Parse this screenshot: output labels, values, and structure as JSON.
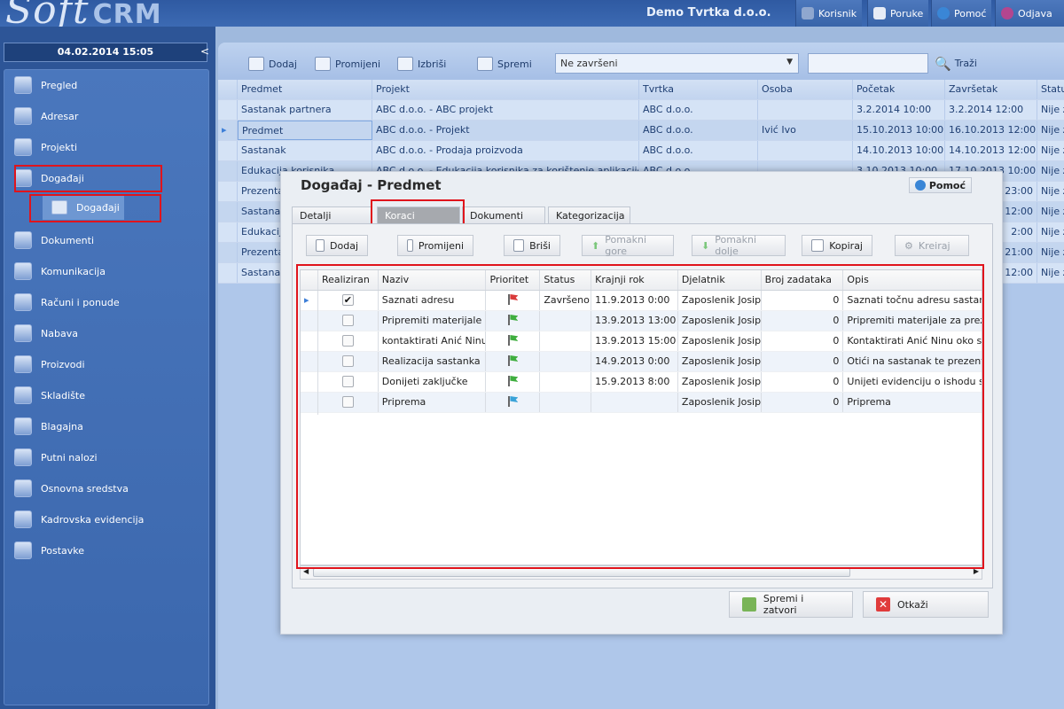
{
  "app": {
    "logo_main": "Soft",
    "logo_sub": "CRM",
    "company": "Demo Tvrtka d.o.o."
  },
  "topbar": {
    "korisnik": "Korisnik",
    "poruke": "Poruke",
    "pomoc": "Pomoć",
    "odjava": "Odjava"
  },
  "left": {
    "datetime": "04.02.2014 15:05",
    "collapse": "<",
    "nav": [
      "Pregled",
      "Adresar",
      "Projekti",
      "Događaji",
      "Dokumenti",
      "Komunikacija",
      "Računi i ponude",
      "Nabava",
      "Proizvodi",
      "Skladište",
      "Blagajna",
      "Putni nalozi",
      "Osnovna sredstva",
      "Kadrovska evidencija",
      "Postavke"
    ],
    "sub": "Događaji"
  },
  "toolbar": {
    "add": "Dodaj",
    "edit": "Promijeni",
    "delete": "Izbriši",
    "save": "Spremi",
    "filter": "Ne završeni",
    "search": "Traži"
  },
  "grid": {
    "headers": [
      "Predmet",
      "Projekt",
      "Tvrtka",
      "Osoba",
      "Početak",
      "Završetak",
      "Status"
    ],
    "rows": [
      [
        "Sastanak partnera",
        "ABC d.o.o. - ABC projekt",
        "ABC d.o.o.",
        "",
        "3.2.2014 10:00",
        "3.2.2014 12:00",
        "Nije z"
      ],
      [
        "Predmet",
        "ABC d.o.o. - Projekt",
        "ABC d.o.o.",
        "Ivić Ivo",
        "15.10.2013 10:00",
        "16.10.2013 12:00",
        "Nije z"
      ],
      [
        "Sastanak",
        "ABC d.o.o. - Prodaja proizvoda",
        "ABC d.o.o.",
        "",
        "14.10.2013 10:00",
        "14.10.2013 12:00",
        "Nije z"
      ],
      [
        "Edukacija korisnika",
        "ABC d.o.o. - Edukacija korisnika za korištenje aplikacije",
        "ABC d.o.o.",
        "",
        "3.10.2013 10:00",
        "17.10.2013 10:00",
        "Nije z"
      ],
      [
        "Prezenta",
        "",
        "",
        "",
        "",
        "23:00",
        "Nije z"
      ],
      [
        "Sastanal",
        "",
        "",
        "",
        "",
        "12:00",
        "Nije z"
      ],
      [
        "Edukacij",
        "",
        "",
        "",
        "",
        "2:00",
        "Nije z"
      ],
      [
        "Prezenta",
        "",
        "",
        "",
        "",
        "21:00",
        "Nije z"
      ],
      [
        "Sastanal",
        "",
        "",
        "",
        "",
        "12:00",
        "Nije z"
      ]
    ]
  },
  "dialog": {
    "title": "Događaj - Predmet",
    "help": "Pomoć",
    "tabs": [
      "Detalji",
      "Koraci",
      "Dokumenti",
      "Kategorizacija"
    ],
    "actions": [
      "Dodaj",
      "Promijeni",
      "Briši",
      "Pomakni gore",
      "Pomakni dolje",
      "Kopiraj",
      "Kreiraj"
    ],
    "steps_headers": [
      "Realiziran",
      "Naziv",
      "Prioritet",
      "Status",
      "Krajnji rok",
      "Djelatnik",
      "Broj zadataka",
      "Opis"
    ],
    "steps": [
      {
        "done": true,
        "name": "Saznati adresu",
        "flag": "#d93b3b",
        "status": "Završeno",
        "due": "11.9.2013 0:00",
        "worker": "Zaposlenik Josip",
        "count": "0",
        "desc": "Saznati točnu adresu sastan"
      },
      {
        "done": false,
        "name": "Pripremiti materijale",
        "flag": "#3fae3f",
        "status": "",
        "due": "13.9.2013 13:00",
        "worker": "Zaposlenik Josip",
        "count": "0",
        "desc": "Pripremiti materijale za prez"
      },
      {
        "done": false,
        "name": "kontaktirati Anić Ninu",
        "flag": "#3fae3f",
        "status": "",
        "due": "13.9.2013 15:00",
        "worker": "Zaposlenik Josip",
        "count": "0",
        "desc": "Kontaktirati Anić Ninu oko sv"
      },
      {
        "done": false,
        "name": "Realizacija sastanka",
        "flag": "#3fae3f",
        "status": "",
        "due": "14.9.2013 0:00",
        "worker": "Zaposlenik Josip",
        "count": "0",
        "desc": "Otići na sastanak te prezent"
      },
      {
        "done": false,
        "name": "Donijeti zaključke",
        "flag": "#3fae3f",
        "status": "",
        "due": "15.9.2013 8:00",
        "worker": "Zaposlenik Josip",
        "count": "0",
        "desc": "Unijeti evidenciju o ishodu s"
      },
      {
        "done": false,
        "name": "Priprema",
        "flag": "#3aa3d8",
        "status": "",
        "due": "",
        "worker": "Zaposlenik Josip",
        "count": "0",
        "desc": "Priprema"
      }
    ],
    "save_close": "Spremi i zatvori",
    "cancel": "Otkaži"
  }
}
